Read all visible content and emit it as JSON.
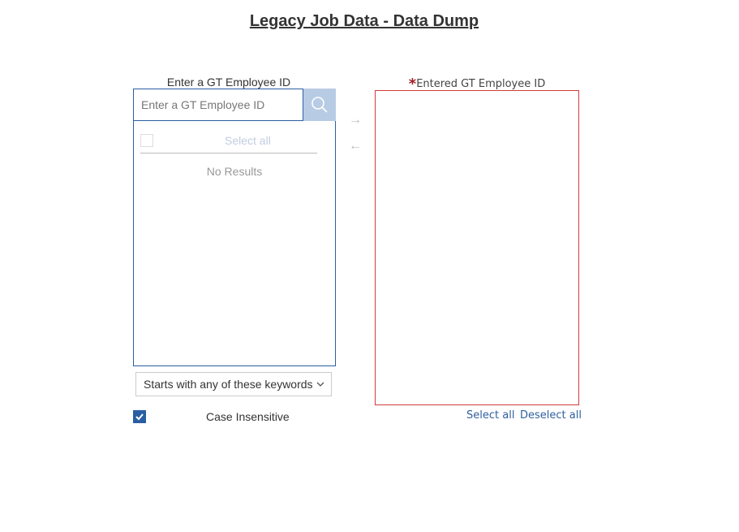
{
  "page": {
    "title": "Legacy Job Data - Data Dump"
  },
  "left_panel": {
    "label": "Enter a GT Employee ID",
    "search_placeholder": "Enter a GT Employee ID",
    "search_value": "",
    "select_all_label": "Select all",
    "no_results": "No Results",
    "match_mode": "Starts with any of these keywords",
    "case_insensitive_label": "Case Insensitive",
    "case_insensitive_checked": true
  },
  "transfer": {
    "add_icon": "arrow-right-icon",
    "remove_icon": "arrow-left-icon"
  },
  "right_panel": {
    "required_marker": "*",
    "label": "Entered GT Employee ID",
    "items": [],
    "select_all_link": "Select all",
    "deselect_all_link": "Deselect all"
  },
  "colors": {
    "accent": "#2a5ea3",
    "search_button": "#b8cbe4",
    "required": "#a31f24",
    "error_border": "#d13b3b",
    "link": "#2f5f9e"
  }
}
